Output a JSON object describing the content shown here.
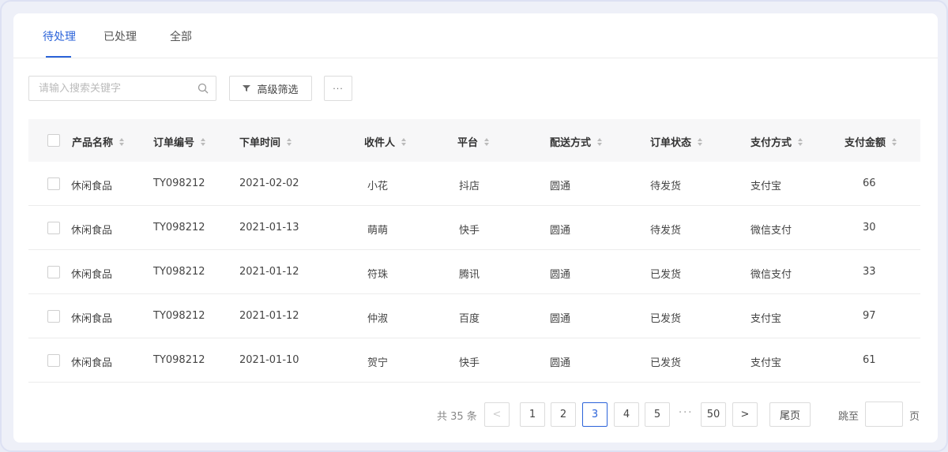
{
  "tabs": [
    {
      "label": "待处理",
      "active": true
    },
    {
      "label": "已处理",
      "active": false
    },
    {
      "label": "全部",
      "active": false
    }
  ],
  "toolbar": {
    "search_placeholder": "请输入搜索关键字",
    "search_value": "",
    "filter_label": "高级筛选",
    "more_label": "···"
  },
  "table": {
    "columns": [
      "产品名称",
      "订单编号",
      "下单时间",
      "收件人",
      "平台",
      "配送方式",
      "订单状态",
      "支付方式",
      "支付金额"
    ],
    "rows": [
      [
        "休闲食品",
        "TY098212",
        "2021-02-02",
        "小花",
        "抖店",
        "圆通",
        "待发货",
        "支付宝",
        "66"
      ],
      [
        "休闲食品",
        "TY098212",
        "2021-01-13",
        "萌萌",
        "快手",
        "圆通",
        "待发货",
        "微信支付",
        "30"
      ],
      [
        "休闲食品",
        "TY098212",
        "2021-01-12",
        "符珠",
        "腾讯",
        "圆通",
        "已发货",
        "微信支付",
        "33"
      ],
      [
        "休闲食品",
        "TY098212",
        "2021-01-12",
        "仲淑",
        "百度",
        "圆通",
        "已发货",
        "支付宝",
        "97"
      ],
      [
        "休闲食品",
        "TY098212",
        "2021-01-10",
        "贺宁",
        "快手",
        "圆通",
        "已发货",
        "支付宝",
        "61"
      ]
    ]
  },
  "pagination": {
    "total_text": "共 35 条",
    "prev_label": "<",
    "next_label": ">",
    "pages": [
      "1",
      "2",
      "3",
      "4",
      "5"
    ],
    "current_page": "3",
    "ellipsis": "···",
    "last_number": "50",
    "last_page_label": "尾页",
    "jump_label": "跳至",
    "jump_value": "",
    "jump_suffix": "页"
  },
  "colors": {
    "accent": "#2b63d9",
    "header_bg": "#f7f7f8",
    "border": "#dcdcdc"
  }
}
